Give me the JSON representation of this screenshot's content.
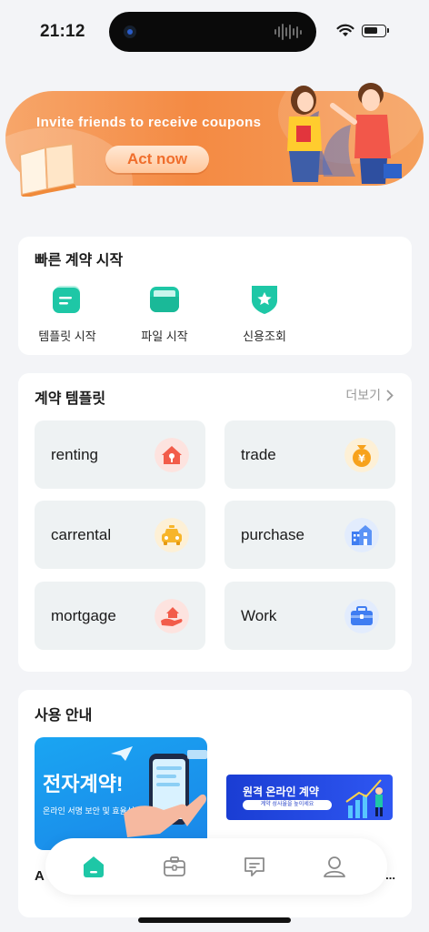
{
  "status_bar": {
    "time": "21:12"
  },
  "banner": {
    "text": "Invite friends to receive coupons",
    "button": "Act now"
  },
  "quick_start": {
    "title": "빠른 계약 시작",
    "items": [
      {
        "label": "템플릿 시작",
        "icon": "template-icon"
      },
      {
        "label": "파일 시작",
        "icon": "folder-icon"
      },
      {
        "label": "신용조회",
        "icon": "shield-star-icon"
      }
    ]
  },
  "templates": {
    "title": "계약 템플릿",
    "more": "더보기",
    "items": [
      {
        "label": "renting",
        "icon": "house-key-icon",
        "color": "#f25c4a"
      },
      {
        "label": "trade",
        "icon": "money-bag-icon",
        "color": "#f7a21c"
      },
      {
        "label": "carrental",
        "icon": "car-icon",
        "color": "#f7b52a"
      },
      {
        "label": "purchase",
        "icon": "building-icon",
        "color": "#3f7df2"
      },
      {
        "label": "mortgage",
        "icon": "hand-house-icon",
        "color": "#f25c4a"
      },
      {
        "label": "Work",
        "icon": "briefcase-icon",
        "color": "#3f7df2"
      }
    ]
  },
  "guide": {
    "title": "사용 안내",
    "card1": {
      "heading": "전자계약!",
      "sub": "온라인 서명  보안 및 효율성"
    },
    "card2": {
      "heading": "원격 온라인 계약",
      "sub": "계약 성사율을 높이세요"
    },
    "caption_left": "A",
    "caption_right": "..."
  },
  "nav": {
    "items": [
      {
        "icon": "home-icon",
        "active": true
      },
      {
        "icon": "briefcase-icon"
      },
      {
        "icon": "message-icon"
      },
      {
        "icon": "profile-icon"
      }
    ]
  },
  "colors": {
    "accent": "#1ec7a6",
    "banner": "#f48a43",
    "blue": "#1a86e8"
  }
}
